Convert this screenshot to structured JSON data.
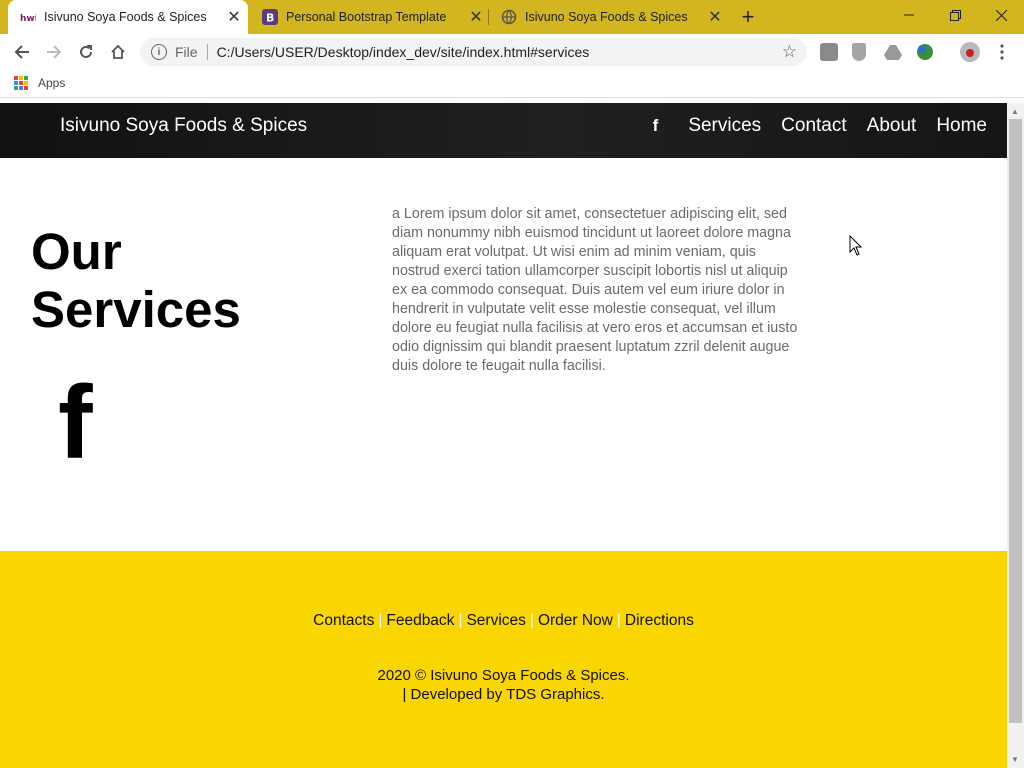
{
  "browser": {
    "tabs": [
      {
        "title": "Isivuno Soya Foods & Spices",
        "icon": "page-favicon-icon"
      },
      {
        "title": "Personal Bootstrap Template",
        "icon": "bootstrap-icon"
      },
      {
        "title": "Isivuno Soya Foods & Spices",
        "icon": "globe-icon"
      }
    ],
    "address": {
      "scheme": "File",
      "url": "C:/Users/USER/Desktop/index_dev/site/index.html#services"
    },
    "bookmarks": {
      "apps_label": "Apps"
    }
  },
  "site": {
    "brand": "Isivuno Soya Foods & Spices",
    "nav": {
      "facebook": "f",
      "services": "Services",
      "contact": "Contact",
      "about": "About",
      "home": "Home"
    },
    "services": {
      "heading_line1": "Our",
      "heading_line2": "Services",
      "facebook_glyph": "f",
      "body": "a Lorem ipsum dolor sit amet, consectetuer adipiscing elit, sed diam nonummy nibh euismod tincidunt ut laoreet dolore magna aliquam erat volutpat. Ut wisi enim ad minim veniam, quis nostrud exerci tation ullamcorper suscipit lobortis nisl ut aliquip ex ea commodo consequat. Duis autem vel eum iriure dolor in hendrerit in vulputate velit esse molestie consequat, vel illum dolore eu feugiat nulla facilisis at vero eros et accumsan et iusto odio dignissim qui blandit praesent luptatum zzril delenit augue duis dolore te feugait nulla facilisi."
    },
    "footer": {
      "links": {
        "contacts": "Contacts",
        "feedback": "Feedback",
        "services": "Services",
        "order_now": "Order Now",
        "directions": "Directions"
      },
      "separator": "|",
      "copyright_line1": "2020 © Isivuno Soya Foods & Spices.",
      "copyright_line2": "| Developed by TDS Graphics."
    }
  },
  "colors": {
    "tabbar": "#d3b520",
    "nav_bg": "#111111",
    "footer_bg": "#f9d600",
    "body_text": "#6b6b6b"
  }
}
